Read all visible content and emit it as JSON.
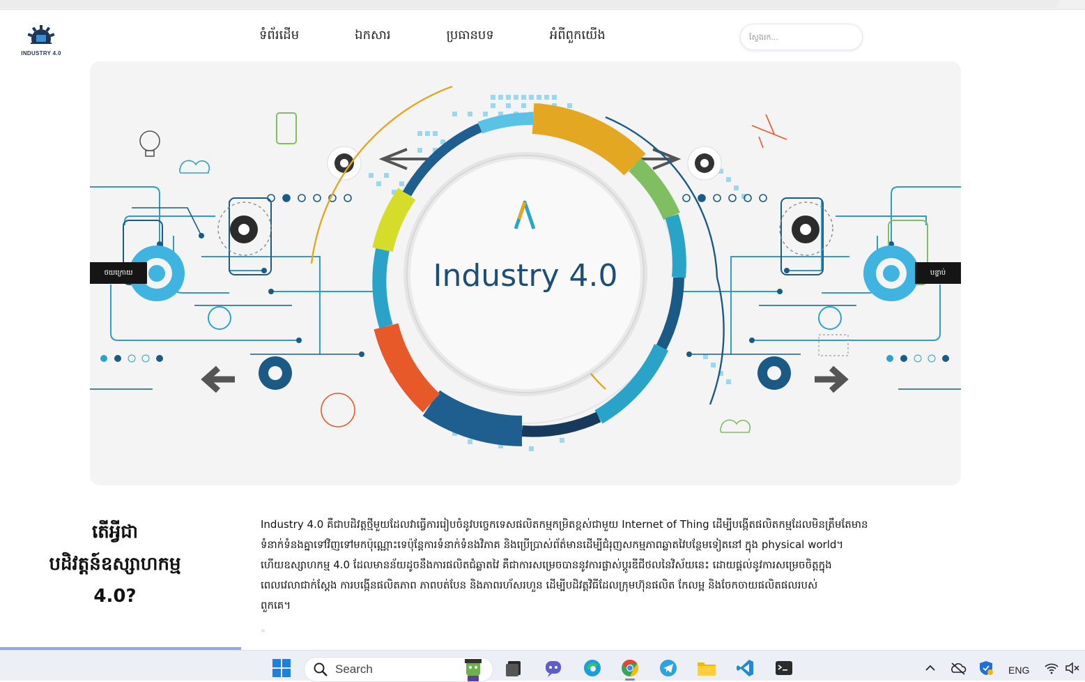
{
  "browser": {
    "strip": ""
  },
  "header": {
    "logo_text": "INDUSTRY 4.0",
    "nav": [
      "ទំព័រដើម",
      "ឯកសារ",
      "ប្រធានបទ",
      "អំពីពួកយើង"
    ],
    "search_placeholder": "ស្វែងរក..."
  },
  "hero": {
    "title": "Industry 4.0",
    "prev_label": "ថយក្រោយ",
    "next_label": "បន្ទាប់",
    "colors": {
      "navy": "#1c5a86",
      "teal": "#2aa3c9",
      "sky": "#59c3e6",
      "amber": "#e4a722",
      "orange": "#e8592a",
      "green": "#7fbf62",
      "lime": "#d6dc2a"
    }
  },
  "article": {
    "title_lines": [
      "តើអ្វីជា",
      "បដិវត្តន៍ឧស្សាហកម្ម",
      "4.0?"
    ],
    "paragraph_lines": [
      "Industry 4.0 គឺជាបដិវត្តថ្មីមួយដែលវាធ្វើការរៀបចំនូវបច្ចេកទេសផលិតកម្មកម្រិតខ្ពស់ជាមួយ Internet of Thing ដើម្បីបង្កើតផលិតកម្មដែលមិនត្រឹមតែមាន",
      "ទំនាក់ទំនងគ្នាទៅវិញទៅមកប៉ុណ្ណោះទេប៉ុន្តែការទំនាក់ទំនងវិភាគ និងប្រើប្រាស់ព័ត៌មានដើម្បីជំរុញសកម្មភាពឆ្លាតវៃបន្ថែមទៀតនៅ ក្នុង physical world។",
      "ហើយឧស្សាហកម្ម 4.0 ដែលមានន័យដូចនឹងការផលិតជំឆ្លាតវៃ គឺជាការសម្រេចបាននូវការផ្លាស់ប្តូរឌីជីថលនៃវិស័យនេះ ដោយផ្តល់នូវការសម្រេចចិត្តក្នុង",
      "ពេលវេលាជាក់ស្តែង ការបង្កើនផលិតភាព ភាពបត់បែន និងភាពរហ័សរហួន ដើម្បីបដិវត្តវិធីដែលក្រុមហ៊ុនផលិត កែលម្អ និងចែកចាយផលិតផលរបស់",
      "ពួកគេ។"
    ],
    "mark": ">"
  },
  "taskbar": {
    "search_label": "Search",
    "language": "ENG",
    "icons": [
      "windows-start-icon",
      "search-icon",
      "widget-character-icon",
      "file-explorer-dark-icon",
      "teams-chat-icon",
      "edge-icon",
      "chrome-icon",
      "telegram-icon",
      "folder-icon",
      "vscode-icon",
      "terminal-icon",
      "chevron-up-icon",
      "onedrive-icon",
      "security-shield-icon",
      "wifi-icon",
      "volume-muted-icon"
    ]
  }
}
